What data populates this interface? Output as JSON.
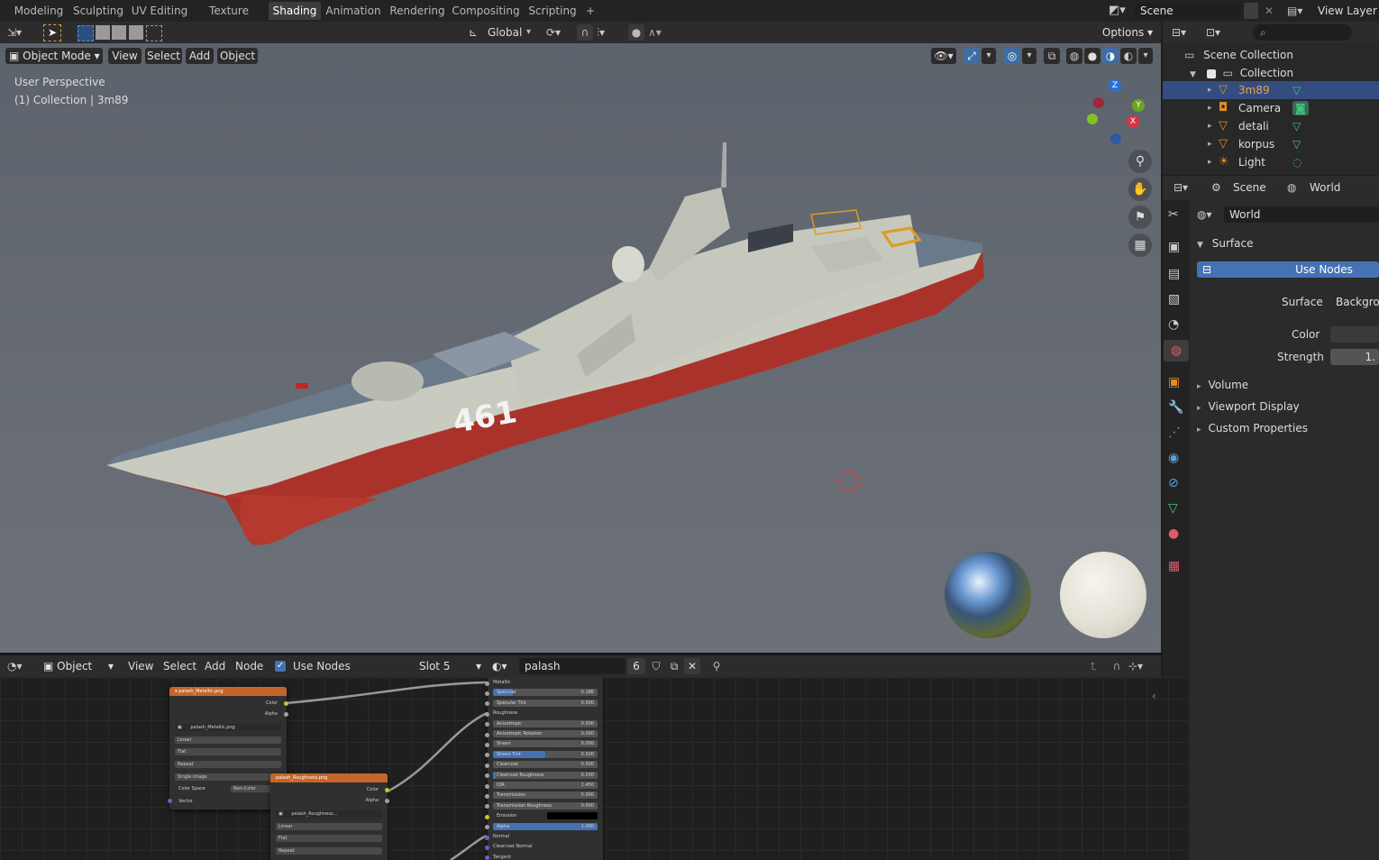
{
  "workspace_tabs": [
    {
      "label": "Modeling"
    },
    {
      "label": "Sculpting"
    },
    {
      "label": "UV Editing"
    },
    {
      "label": "Texture Paint"
    },
    {
      "label": "Shading"
    },
    {
      "label": "Animation"
    },
    {
      "label": "Rendering"
    },
    {
      "label": "Compositing"
    },
    {
      "label": "Scripting"
    },
    {
      "label": "+"
    }
  ],
  "active_tab": "Shading",
  "scene": {
    "name": "Scene",
    "view_layer": "View Layer"
  },
  "toolbar": {
    "transform_orientation": "Global",
    "options_label": "Options"
  },
  "viewport_header": {
    "mode": "Object Mode",
    "menus": [
      "View",
      "Select",
      "Add",
      "Object"
    ]
  },
  "viewport": {
    "perspective_label": "User Perspective",
    "collection_label": "(1) Collection | 3m89",
    "hull_number": "461",
    "gizmo": {
      "x_label": "X",
      "y_label": "Y",
      "z_label": "Z"
    },
    "colors": {
      "hull_red": "#b2352a",
      "hull_grey": "#c9cbc0",
      "deck": "#6b7a8a"
    }
  },
  "outliner": {
    "root": "Scene Collection",
    "collection": "Collection",
    "items": [
      {
        "name": "3m89",
        "selected": true
      },
      {
        "name": "Camera",
        "selected": false
      },
      {
        "name": "detali",
        "selected": false
      },
      {
        "name": "korpus",
        "selected": false
      },
      {
        "name": "Light",
        "selected": false
      }
    ]
  },
  "properties": {
    "breadcrumb_scene": "Scene",
    "breadcrumb_world": "World",
    "world_name": "World",
    "surface_panel": "Surface",
    "use_nodes_button": "Use Nodes",
    "surface_label": "Surface",
    "surface_value": "Backgrou",
    "color_label": "Color",
    "strength_label": "Strength",
    "strength_value": "1.",
    "collapsed_panels": [
      "Volume",
      "Viewport Display",
      "Custom Properties"
    ]
  },
  "node_editor_header": {
    "object_type": "Object",
    "menus": [
      "View",
      "Select",
      "Add",
      "Node"
    ],
    "use_nodes_label": "Use Nodes",
    "use_nodes_checked": true,
    "slot": "Slot 5",
    "material": "palash",
    "users": "6"
  },
  "nodes": {
    "metallic": {
      "title": "palash_Metallic.png",
      "outputs": [
        "Color",
        "Alpha"
      ],
      "image": "palash_Metallic.png",
      "interpolation": "Linear",
      "projection": "Flat",
      "extension": "Repeat",
      "source": "Single Image",
      "color_space_label": "Color Space",
      "color_space": "Non-Color",
      "input": "Vector"
    },
    "roughness": {
      "title": "palash_Roughness.png",
      "outputs": [
        "Color",
        "Alpha"
      ],
      "image": "palash_Roughness...",
      "interpolation": "Linear",
      "projection": "Flat",
      "extension": "Repeat"
    },
    "bsdf_rows": [
      {
        "label": "Metallic",
        "value": "",
        "kind": "label"
      },
      {
        "label": "Specular",
        "value": "0.186",
        "kind": "bar",
        "fill": 0.19
      },
      {
        "label": "Specular Tint",
        "value": "0.000",
        "kind": "bar",
        "fill": 0
      },
      {
        "label": "Roughness",
        "value": "",
        "kind": "label"
      },
      {
        "label": "Anisotropic",
        "value": "0.000",
        "kind": "bar",
        "fill": 0
      },
      {
        "label": "Anisotropic Rotation",
        "value": "0.000",
        "kind": "bar",
        "fill": 0
      },
      {
        "label": "Sheen",
        "value": "0.000",
        "kind": "bar",
        "fill": 0
      },
      {
        "label": "Sheen Tint",
        "value": "0.500",
        "kind": "bar",
        "fill": 0.5
      },
      {
        "label": "Clearcoat",
        "value": "0.000",
        "kind": "bar",
        "fill": 0
      },
      {
        "label": "Clearcoat Roughness",
        "value": "0.030",
        "kind": "bar",
        "fill": 0.03
      },
      {
        "label": "IOR",
        "value": "1.450",
        "kind": "bar",
        "fill": 0
      },
      {
        "label": "Transmission",
        "value": "0.000",
        "kind": "bar",
        "fill": 0
      },
      {
        "label": "Transmission Roughness",
        "value": "0.000",
        "kind": "bar",
        "fill": 0
      },
      {
        "label": "Emission",
        "value": "",
        "kind": "color"
      },
      {
        "label": "Alpha",
        "value": "1.000",
        "kind": "bar",
        "fill": 1
      },
      {
        "label": "Normal",
        "value": "",
        "kind": "label"
      },
      {
        "label": "Clearcoat Normal",
        "value": "",
        "kind": "label"
      },
      {
        "label": "Tangent",
        "value": "",
        "kind": "label"
      }
    ]
  }
}
